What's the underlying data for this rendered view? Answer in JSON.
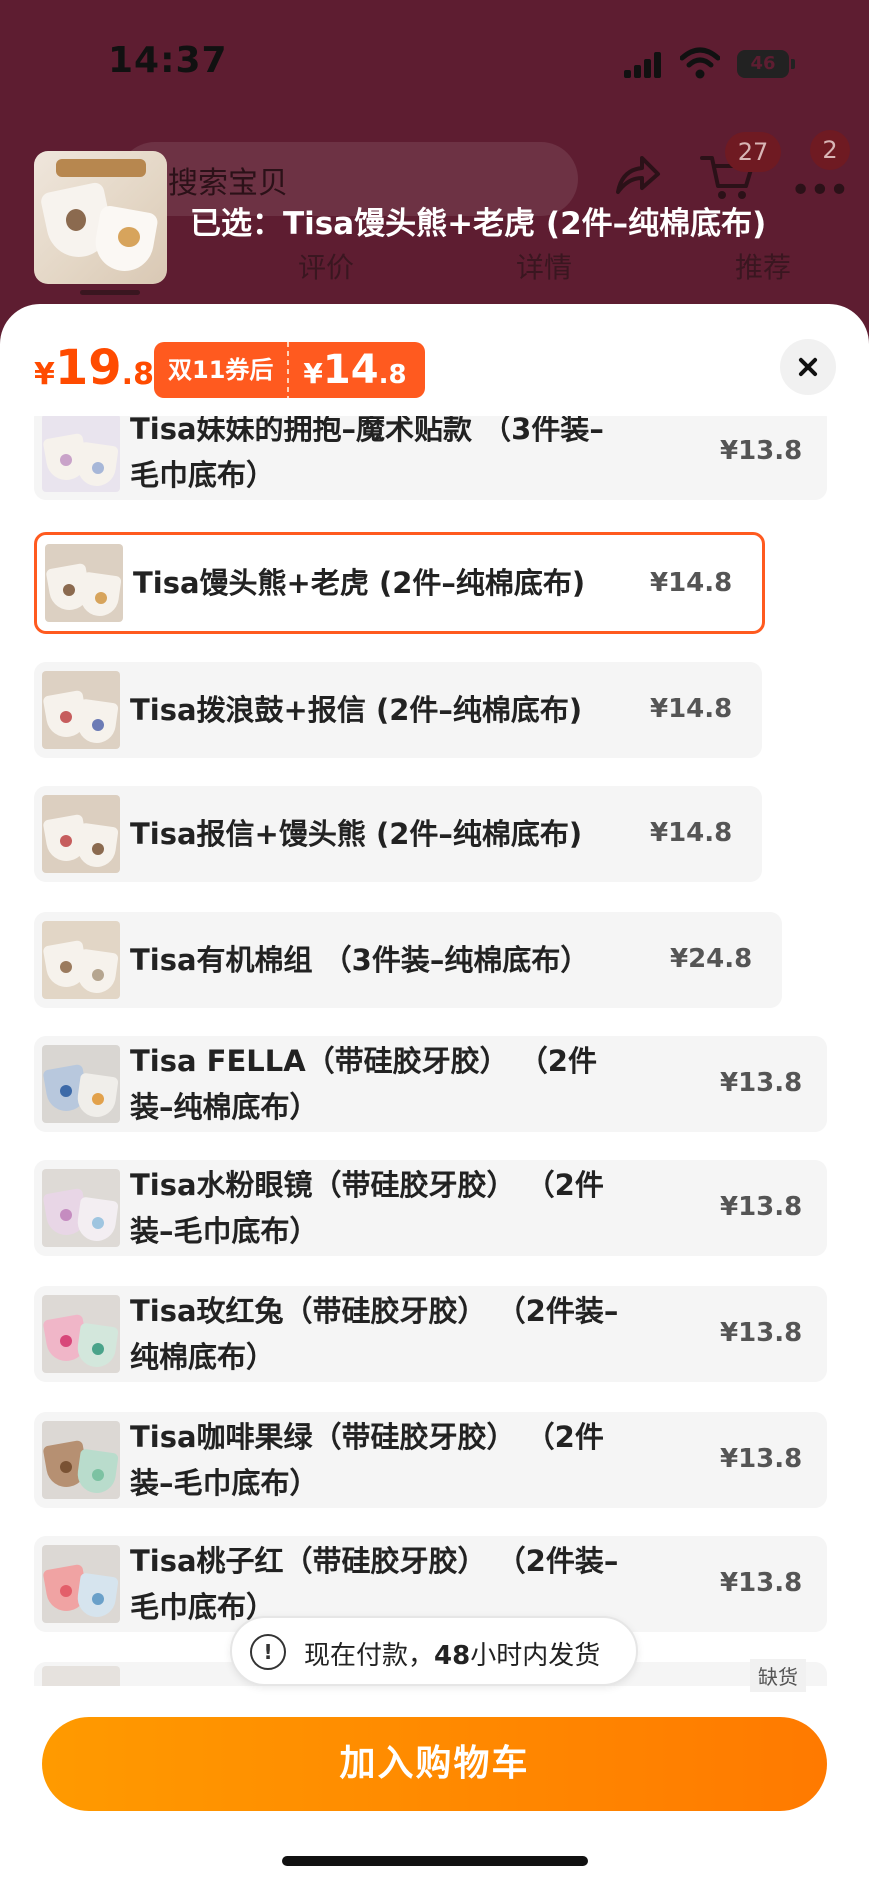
{
  "status": {
    "time": "14:37",
    "battery": "46"
  },
  "header": {
    "search_placeholder": "搜索宝贝",
    "cart_count": "27",
    "more_count": "2",
    "tabs": [
      "评价",
      "详情",
      "推荐"
    ]
  },
  "selected": {
    "text": "已选：Tisa馒头熊+老虎 (2件–纯棉底布)"
  },
  "price": {
    "currency": "¥",
    "main_int": "19",
    "main_dec": ".8",
    "coupon_label": "双11券后",
    "coupon_int": "14",
    "coupon_dec": ".8"
  },
  "skus": [
    {
      "label": "Tisa妹妹的拥抱–魔术贴款 （3件装–毛巾底布）",
      "price": "¥13.8",
      "selected": false
    },
    {
      "label": "Tisa馒头熊+老虎 (2件–纯棉底布)",
      "price": "¥14.8",
      "selected": true
    },
    {
      "label": "Tisa拨浪鼓+报信 (2件–纯棉底布)",
      "price": "¥14.8",
      "selected": false
    },
    {
      "label": "Tisa报信+馒头熊 (2件–纯棉底布)",
      "price": "¥14.8",
      "selected": false
    },
    {
      "label": "Tisa有机棉组 （3件装–纯棉底布）",
      "price": "¥24.8",
      "selected": false
    },
    {
      "label": "Tisa FELLA（带硅胶牙胶） （2件装–纯棉底布）",
      "price": "¥13.8",
      "selected": false
    },
    {
      "label": "Tisa水粉眼镜（带硅胶牙胶） （2件装–毛巾底布）",
      "price": "¥13.8",
      "selected": false
    },
    {
      "label": "Tisa玫红兔（带硅胶牙胶） （2件装–纯棉底布）",
      "price": "¥13.8",
      "selected": false
    },
    {
      "label": "Tisa咖啡果绿（带硅胶牙胶） （2件装–毛巾底布）",
      "price": "¥13.8",
      "selected": false
    },
    {
      "label": "Tisa桃子红（带硅胶牙胶） （2件装–毛巾底布）",
      "price": "¥13.8",
      "selected": false
    }
  ],
  "soldout_label": "缺货",
  "notice": {
    "prefix": "现在付款，",
    "bold": "48",
    "suffix": "小时内发货"
  },
  "add_to_cart_label": "加入购物车",
  "colors": {
    "accent": "#ff5a1f",
    "cta": "#ff8a00"
  }
}
